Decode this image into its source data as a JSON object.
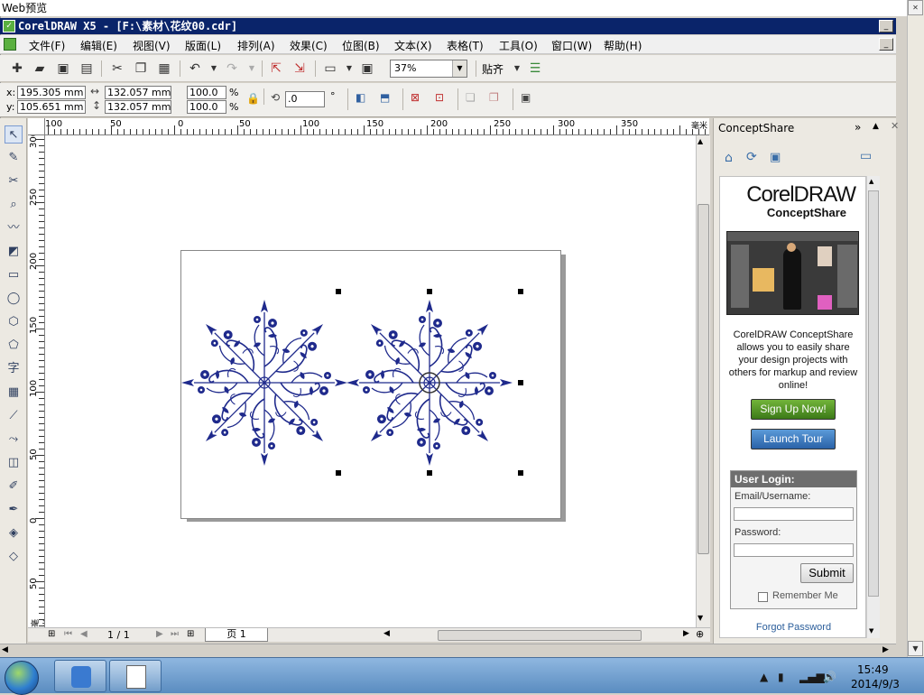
{
  "outer": {
    "title": "Web预览"
  },
  "app": {
    "title": "CorelDRAW X5 - [F:\\素材\\花纹00.cdr]"
  },
  "menu": [
    "文件(F)",
    "编辑(E)",
    "视图(V)",
    "版面(L)",
    "排列(A)",
    "效果(C)",
    "位图(B)",
    "文本(X)",
    "表格(T)",
    "工具(O)",
    "窗口(W)",
    "帮助(H)"
  ],
  "toolbar": {
    "zoom": "37%",
    "snap_label": "贴齐"
  },
  "propbar": {
    "x_label": "x:",
    "y_label": "y:",
    "x": "195.305 mm",
    "y": "105.651 mm",
    "w": "132.057 mm",
    "h": "132.057 mm",
    "sx": "100.0",
    "sy": "100.0",
    "percent": "%",
    "rotation": ".0",
    "degree": "°"
  },
  "ruler": {
    "h": [
      "100",
      "50",
      "0",
      "50",
      "100",
      "150",
      "200",
      "250",
      "300",
      "350",
      "毫米"
    ],
    "v": [
      "300",
      "250",
      "200",
      "150",
      "100",
      "50",
      "0",
      "50",
      "毫米"
    ]
  },
  "pager": {
    "count": "1 / 1",
    "tab": "页 1"
  },
  "docker": {
    "title": "ConceptShare",
    "brand_line1": "CorelDRAW",
    "brand_line2": "ConceptShare",
    "promo": "CorelDRAW ConceptShare allows you to easily share your design projects with others for markup and review online!",
    "signup": "Sign Up Now!",
    "tour": "Launch Tour",
    "login_title": "User Login:",
    "email_label": "Email/Username:",
    "password_label": "Password:",
    "submit": "Submit",
    "remember": "Remember Me",
    "forgot": "Forgot Password"
  },
  "taskbar": {
    "time": "15:49",
    "date": "2014/9/3"
  },
  "colors": {
    "ornament": "#1f2a8c",
    "titlebar": "#0a246a",
    "signup": "#4a8a22",
    "tour": "#3876c0"
  }
}
